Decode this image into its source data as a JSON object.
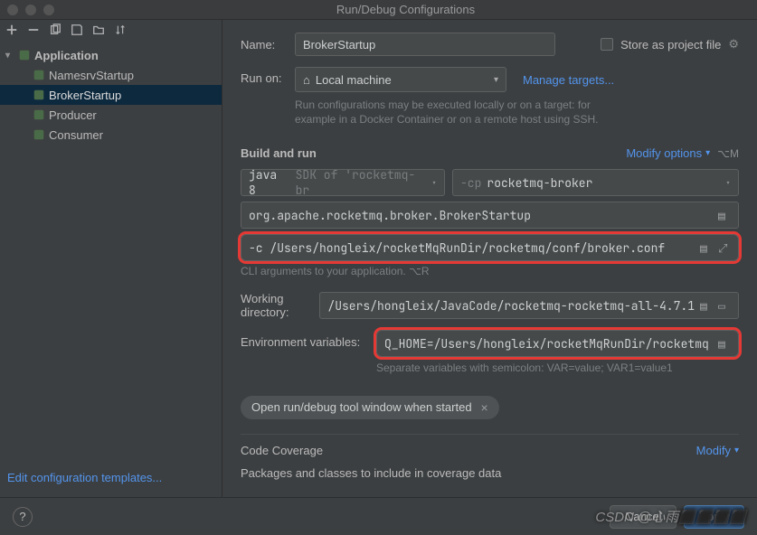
{
  "window": {
    "title": "Run/Debug Configurations"
  },
  "sidebar": {
    "root": "Application",
    "items": [
      {
        "label": "NamesrvStartup"
      },
      {
        "label": "BrokerStartup"
      },
      {
        "label": "Producer"
      },
      {
        "label": "Consumer"
      }
    ],
    "selected_index": 1
  },
  "form": {
    "name_label": "Name:",
    "name_value": "BrokerStartup",
    "store_label": "Store as project file",
    "runon_label": "Run on:",
    "runon_value": "Local machine",
    "manage_targets": "Manage targets...",
    "runon_hint": "Run configurations may be executed locally or on a target: for example in a Docker Container or on a remote host using SSH."
  },
  "build": {
    "section": "Build and run",
    "modify": "Modify options",
    "modify_shortcut": "⌥M",
    "jdk_primary": "java 8",
    "jdk_secondary": "SDK of 'rocketmq-br",
    "cp_prefix": "-cp",
    "cp_value": "rocketmq-broker",
    "main_class": "org.apache.rocketmq.broker.BrokerStartup",
    "cli_args": "-c /Users/hongleix/rocketMqRunDir/rocketmq/conf/broker.conf",
    "cli_hint": "CLI arguments to your application. ⌥R",
    "wd_label": "Working directory:",
    "wd_value": "/Users/hongleix/JavaCode/rocketmq-rocketmq-all-4.7.1",
    "env_label": "Environment variables:",
    "env_value": "Q_HOME=/Users/hongleix/rocketMqRunDir/rocketmq",
    "env_hint": "Separate variables with semicolon: VAR=value; VAR1=value1",
    "chip": "Open run/debug tool window when started"
  },
  "coverage": {
    "section": "Code Coverage",
    "modify": "Modify",
    "packages": "Packages and classes to include in coverage data"
  },
  "footer": {
    "edit_templates": "Edit configuration templates...",
    "cancel": "Cancel",
    "apply": "Apply"
  },
  "watermark": "CSDN @心雨⬛⬛⬛⬛"
}
